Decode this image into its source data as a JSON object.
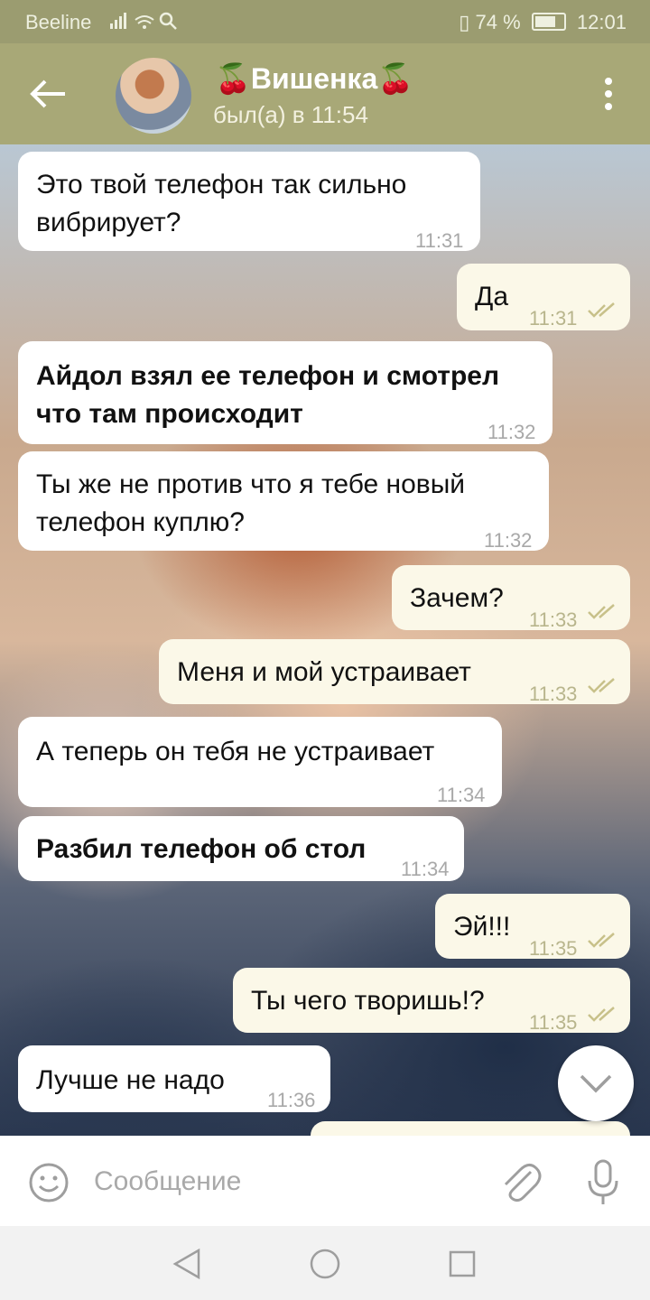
{
  "status_bar": {
    "carrier": "Beeline",
    "battery": "74 %",
    "time": "12:01"
  },
  "header": {
    "name": "🍒Вишенка🍒",
    "last_seen": "был(а) в 11:54"
  },
  "messages": [
    {
      "direction": "in",
      "text_line1": "Это твой телефон так сильно",
      "text_line2": "вибрирует?",
      "time": "11:31",
      "bold": false
    },
    {
      "direction": "out",
      "text_line1": "Да",
      "text_line2": "",
      "time": "11:31"
    },
    {
      "direction": "in",
      "text_line1": "Айдол взял ее телефон и смотрел",
      "text_line2": "что там происходит",
      "time": "11:32",
      "bold": true
    },
    {
      "direction": "in",
      "text_line1": "Ты же не против что я тебе новый",
      "text_line2": "телефон куплю?",
      "time": "11:32",
      "bold": false
    },
    {
      "direction": "out",
      "text_line1": "Зачем?",
      "text_line2": "",
      "time": "11:33"
    },
    {
      "direction": "out",
      "text_line1": "Меня и мой устраивает",
      "text_line2": "",
      "time": "11:33"
    },
    {
      "direction": "in",
      "text_line1": "А теперь он тебя не устраивает",
      "text_line2": "",
      "time": "11:34",
      "bold": false
    },
    {
      "direction": "in",
      "text_line1": "Разбил телефон об стол",
      "text_line2": "",
      "time": "11:34",
      "bold": true
    },
    {
      "direction": "out",
      "text_line1": "Эй!!!",
      "text_line2": "",
      "time": "11:35"
    },
    {
      "direction": "out",
      "text_line1": "Ты чего творишь!?",
      "text_line2": "",
      "time": "11:35"
    },
    {
      "direction": "in",
      "text_line1": "Лучше не надо",
      "text_line2": "",
      "time": "11:36",
      "bold": false
    }
  ],
  "input": {
    "placeholder": "Сообщение"
  },
  "colors": {
    "header": "#a8a877",
    "status_bar": "#9b9c70",
    "outgoing_bubble": "#fbf8e8",
    "incoming_bubble": "#ffffff",
    "read_check": "#c8c18a"
  },
  "icons": {
    "back": "arrow-left-icon",
    "menu": "more-vertical-icon",
    "emoji": "smiley-icon",
    "attach": "paperclip-icon",
    "mic": "microphone-icon",
    "scroll_down": "chevron-down-icon"
  }
}
